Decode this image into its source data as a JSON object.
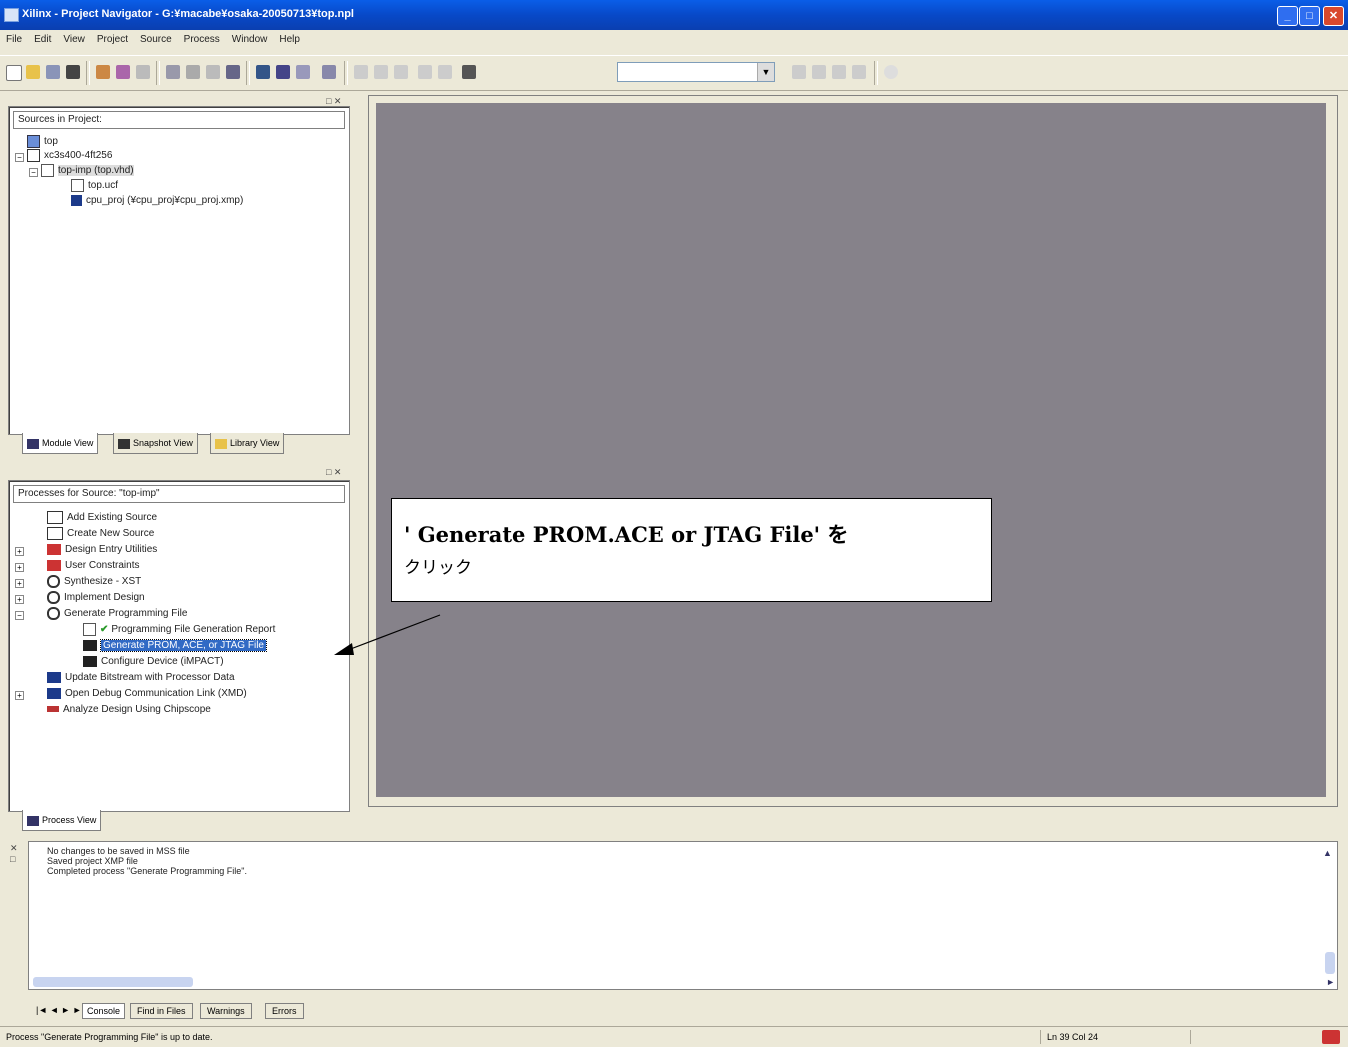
{
  "window": {
    "title": "Xilinx - Project Navigator - G:¥macabe¥osaka-20050713¥top.npl"
  },
  "menu": [
    "File",
    "Edit",
    "View",
    "Project",
    "Source",
    "Process",
    "Window",
    "Help"
  ],
  "toolbar": {
    "combo_value": ""
  },
  "sources": {
    "header": "Sources in Project:",
    "items": [
      "top",
      "xc3s400-4ft256",
      "top-imp (top.vhd)",
      "top.ucf",
      "cpu_proj (¥cpu_proj¥cpu_proj.xmp)"
    ],
    "tabs": [
      "Module View",
      "Snapshot View",
      "Library View"
    ]
  },
  "processes": {
    "header": "Processes for Source: \"top-imp\"",
    "items": [
      "Add Existing Source",
      "Create New Source",
      "Design Entry Utilities",
      "User Constraints",
      "Synthesize - XST",
      "Implement Design",
      "Generate Programming File",
      "Programming File Generation Report",
      "Generate PROM, ACE, or JTAG File",
      "Configure Device (iMPACT)",
      "Update Bitstream with Processor Data",
      "Open Debug Communication Link (XMD)",
      "Analyze Design Using Chipscope"
    ],
    "tab": "Process View"
  },
  "callout": {
    "line1": "' Generate PROM.ACE or JTAG File' を",
    "line2": "クリック"
  },
  "console": {
    "lines": [
      "No changes to be saved in MSS file",
      "Saved project XMP file",
      "Completed process \"Generate Programming File\"."
    ],
    "tabs": [
      "Console",
      "Find in Files",
      "Warnings",
      "Errors"
    ]
  },
  "status": {
    "message": "Process \"Generate Programming File\" is up to date.",
    "position": "Ln 39 Col 24"
  },
  "colors": {
    "titlebar": "#0a4fd0",
    "workspace": "#86828a",
    "selection": "#316ac5"
  }
}
